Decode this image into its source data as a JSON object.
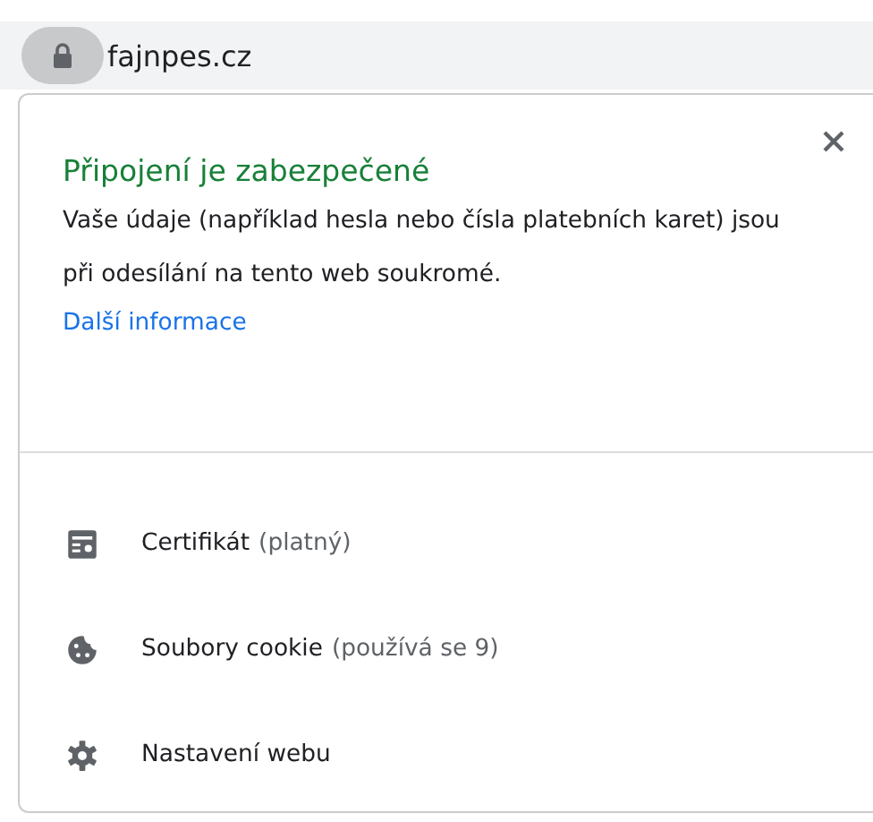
{
  "address_bar": {
    "url": "fajnpes.cz"
  },
  "popup": {
    "title": "Připojení je zabezpečené",
    "description": "Vaše údaje (například hesla nebo čísla platebních karet) jsou při odesílání na tento web soukromé.",
    "link": "Další informace",
    "items": [
      {
        "kind": "certificate",
        "label": "Certifikát",
        "detail": "(platný)"
      },
      {
        "kind": "cookie",
        "label": "Soubory cookie",
        "detail": "(používá se 9)"
      },
      {
        "kind": "settings",
        "label": "Nastavení webu"
      }
    ]
  }
}
